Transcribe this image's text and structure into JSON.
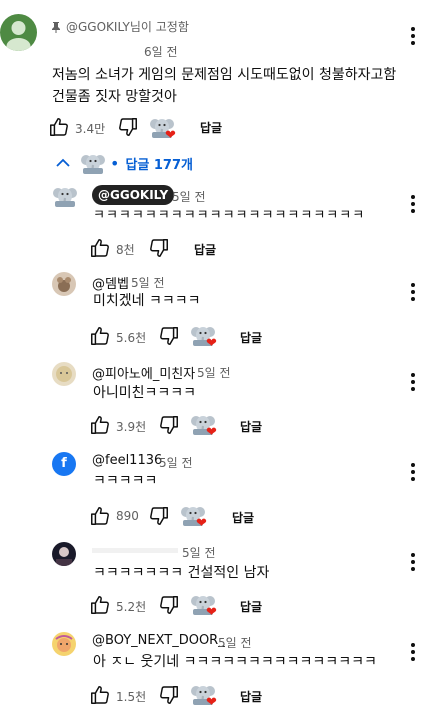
{
  "pinned": {
    "pin_label": "@GGOKILY님이 고정함",
    "time": "6일 전",
    "text_line1": "저놈의 소녀가 게임의 문제점임 시도때도없이 청불하자고함",
    "text_line2": "건물좀 짓자 망할것아",
    "likes": "3.4만",
    "reply_label": "답글",
    "replies_toggle": "답글 177개",
    "avatar_color": "#4e8a43"
  },
  "replies": [
    {
      "author": "@GGOKILY",
      "is_owner": true,
      "time": "5일 전",
      "text": "ㅋㅋㅋㅋㅋㅋㅋㅋㅋㅋㅋㅋㅋㅋㅋㅋㅋㅋㅋㅋㅋ",
      "likes": "8천",
      "reply_label": "답글",
      "heart": false
    },
    {
      "author": "@뎀벱",
      "is_owner": false,
      "time": "5일 전",
      "text": "미치겠네 ㅋㅋㅋㅋ",
      "likes": "5.6천",
      "reply_label": "답글",
      "heart": true
    },
    {
      "author": "@피아노에_미친자",
      "is_owner": false,
      "time": "5일 전",
      "text": "아니미친ㅋㅋㅋㅋ",
      "likes": "3.9천",
      "reply_label": "답글",
      "heart": true
    },
    {
      "author": "@feel1136",
      "is_owner": false,
      "time": "5일 전",
      "text": "ㅋㅋㅋㅋㅋ",
      "likes": "890",
      "reply_label": "답글",
      "heart": true
    },
    {
      "author": "",
      "is_owner": false,
      "time": "5일 전",
      "text": "ㅋㅋㅋㅋㅋㅋㅋ 건설적인 남자",
      "likes": "5.2천",
      "reply_label": "답글",
      "heart": true
    },
    {
      "author": "@BOY_NEXT_DOOR_",
      "is_owner": false,
      "time": "5일 전",
      "text": "아 ㅈㄴ 웃기네 ㅋㅋㅋㅋㅋㅋㅋㅋㅋㅋㅋㅋㅋㅋㅋ",
      "likes": "1.5천",
      "reply_label": "답글",
      "heart": true
    }
  ],
  "colors": {
    "link_blue": "#065fd4",
    "heart_red": "#e62117",
    "owner_badge_bg": "#222222"
  },
  "icons": {
    "like": "thumbs-up-icon",
    "dislike": "thumbs-down-icon",
    "more": "more-vert-icon",
    "pin": "pin-icon"
  }
}
